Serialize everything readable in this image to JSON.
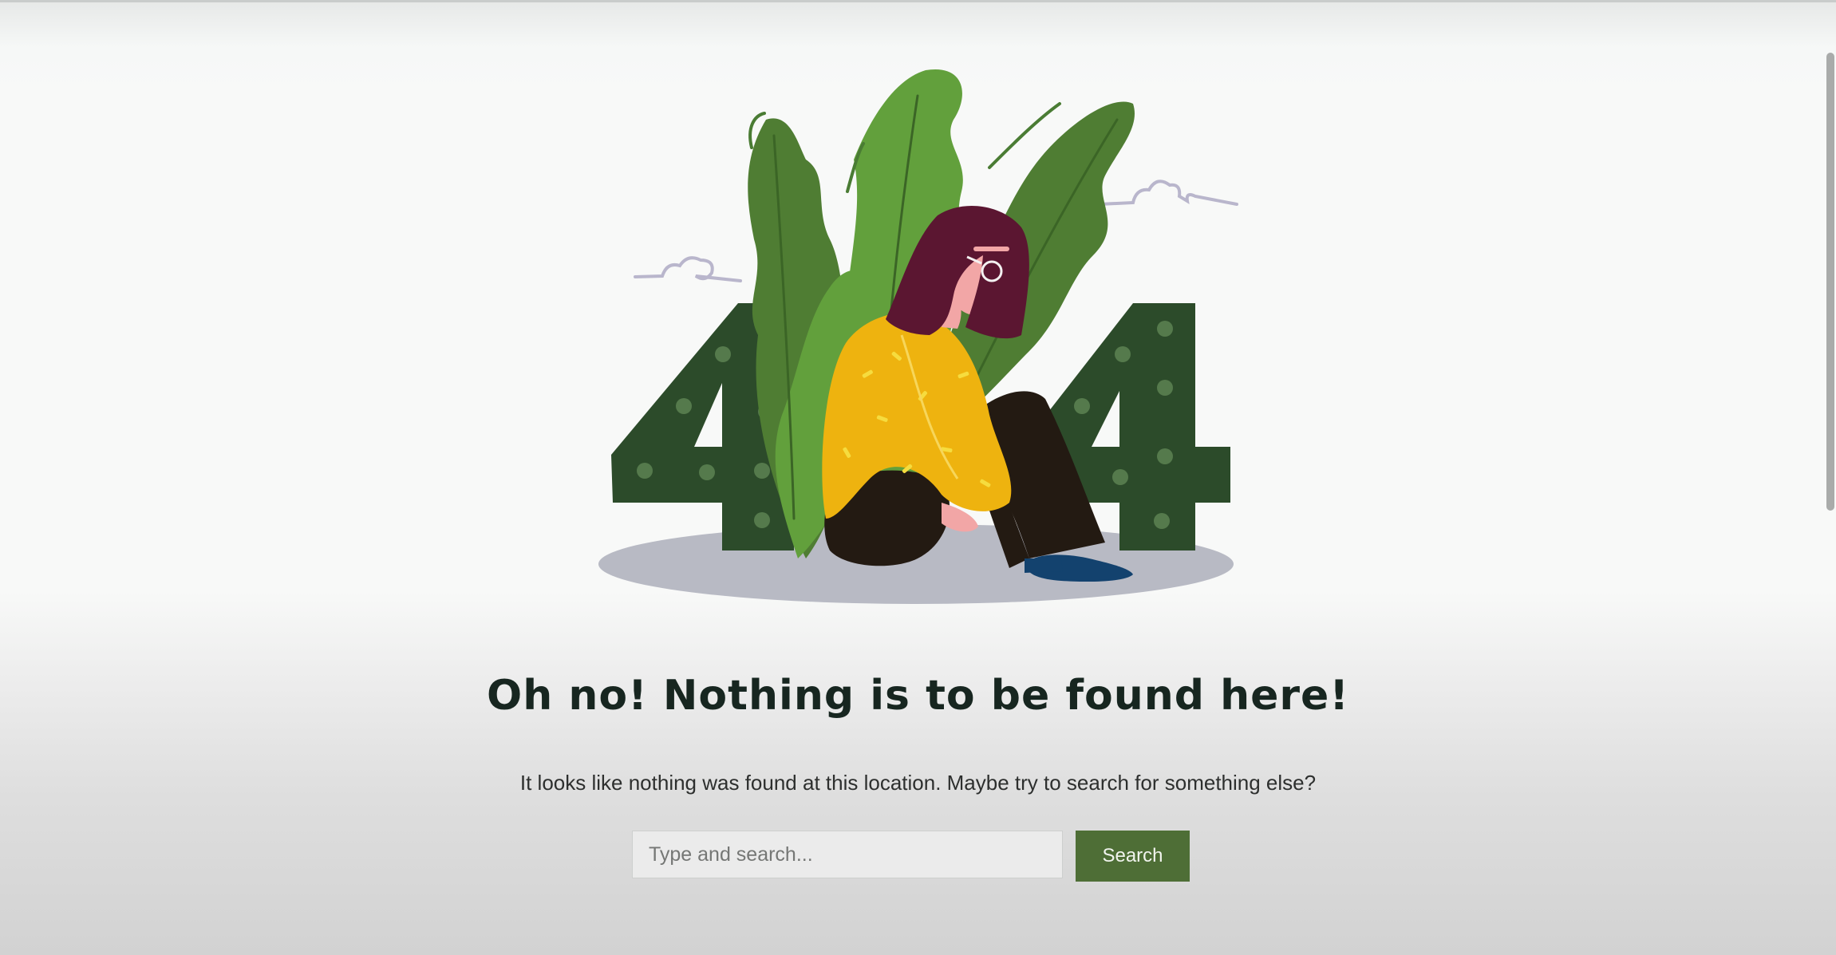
{
  "illustration": {
    "label": "404",
    "colors": {
      "digits": "#2c4b2a",
      "leaf_dark": "#4f7d33",
      "leaf_light": "#62a03c",
      "sweater": "#eeb30f",
      "hair": "#5b1631",
      "pants": "#231a12",
      "shoes": "#13426e",
      "shadow": "#b8bac4"
    }
  },
  "headline": "Oh no! Nothing is to be found here!",
  "subtext": "It looks like nothing was found at this location. Maybe try to search for something else?",
  "search": {
    "placeholder": "Type and search...",
    "button_label": "Search"
  },
  "accent_color": "#4e6e36"
}
